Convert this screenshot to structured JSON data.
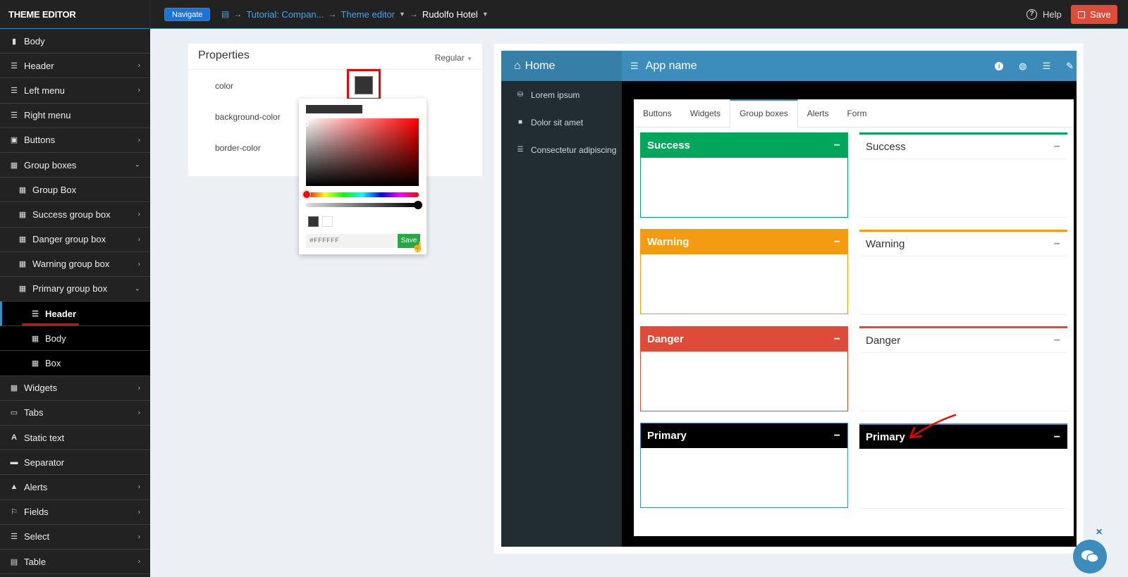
{
  "topbar": {
    "brand": "THEME EDITOR",
    "navigate_label": "Navigate",
    "breadcrumb": [
      "Tutorial: Compan...",
      "Theme editor",
      "Rudolfo Hotel"
    ],
    "help_label": "Help",
    "save_label": "Save"
  },
  "sidebar": {
    "items": [
      {
        "label": "Body",
        "icon": "file-icon",
        "chevron": false
      },
      {
        "label": "Header",
        "icon": "bars-icon",
        "chevron": true
      },
      {
        "label": "Left menu",
        "icon": "left-align-icon",
        "chevron": true
      },
      {
        "label": "Right menu",
        "icon": "right-align-icon",
        "chevron": false
      },
      {
        "label": "Buttons",
        "icon": "button-icon",
        "chevron": true
      },
      {
        "label": "Group boxes",
        "icon": "grid-icon",
        "chevron": true,
        "expanded": true
      },
      {
        "label": "Group Box",
        "icon": "grid-icon",
        "chevron": false
      },
      {
        "label": "Success group box",
        "icon": "grid-icon",
        "chevron": true
      },
      {
        "label": "Danger group box",
        "icon": "grid-icon",
        "chevron": true
      },
      {
        "label": "Warning group box",
        "icon": "grid-icon",
        "chevron": true
      },
      {
        "label": "Primary group box",
        "icon": "grid-icon",
        "chevron": true,
        "expanded": true
      },
      {
        "label": "Header",
        "icon": "bars-icon",
        "chevron": false,
        "active": true
      },
      {
        "label": "Body",
        "icon": "grid-icon",
        "chevron": false
      },
      {
        "label": "Box",
        "icon": "grid-icon",
        "chevron": false
      },
      {
        "label": "Widgets",
        "icon": "widgets-icon",
        "chevron": true
      },
      {
        "label": "Tabs",
        "icon": "folder-icon",
        "chevron": true
      },
      {
        "label": "Static text",
        "icon": "font-icon",
        "chevron": false
      },
      {
        "label": "Separator",
        "icon": "minus-icon",
        "chevron": false
      },
      {
        "label": "Alerts",
        "icon": "warning-icon",
        "chevron": true
      },
      {
        "label": "Fields",
        "icon": "flag-icon",
        "chevron": true
      },
      {
        "label": "Select",
        "icon": "list-icon",
        "chevron": true
      },
      {
        "label": "Table",
        "icon": "table-icon",
        "chevron": true
      }
    ]
  },
  "properties": {
    "title": "Properties",
    "mode": "Regular",
    "rows": [
      "color",
      "background-color",
      "border-color"
    ],
    "color_value": "#333333"
  },
  "picker": {
    "hex_placeholder": "#FFFFFF",
    "save_label": "Save"
  },
  "preview": {
    "home_label": "Home",
    "app_name": "App name",
    "side_items": [
      {
        "label": "Lorem ipsum",
        "icon": "database-icon"
      },
      {
        "label": "Dolor sit amet",
        "icon": "lock-icon"
      },
      {
        "label": "Consectetur adipiscing",
        "icon": "bars-icon"
      }
    ],
    "tabs": [
      "Buttons",
      "Widgets",
      "Group boxes",
      "Alerts",
      "Form"
    ],
    "active_tab": "Group boxes",
    "boxes_solid": [
      {
        "label": "Success",
        "color": "#00a65a"
      },
      {
        "label": "Warning",
        "color": "#f39c12"
      },
      {
        "label": "Danger",
        "color": "#dd4b39"
      },
      {
        "label": "Primary",
        "color": "#000000",
        "border": "#3c8dbc"
      }
    ],
    "boxes_outline": [
      {
        "label": "Success",
        "color": "#00a65a"
      },
      {
        "label": "Warning",
        "color": "#f39c12"
      },
      {
        "label": "Danger",
        "color": "#dd4b39"
      },
      {
        "label": "Primary",
        "color": "#3c8dbc"
      }
    ],
    "minimize_symbol": "−"
  },
  "colors": {
    "accent": "#3c8dbc",
    "danger": "#dd4b39",
    "highlight": "#ee0000"
  }
}
